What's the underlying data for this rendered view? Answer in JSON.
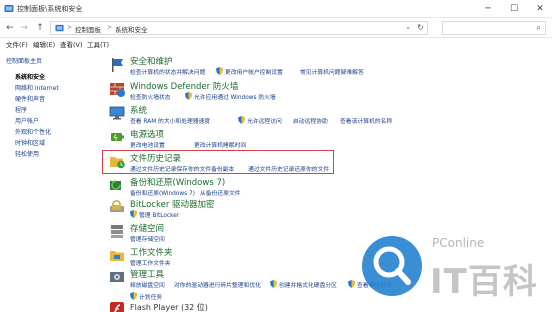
{
  "window": {
    "title": "控制面板\\系统和安全",
    "min_label": "─",
    "max_label": "☐",
    "close_label": "✕"
  },
  "nav": {
    "back": "←",
    "forward": "→",
    "up": "↑",
    "breadcrumb": [
      "控制面板",
      "系统和安全"
    ],
    "separator": ">",
    "dropdown": "⌄",
    "refresh": "↻",
    "search_icon": "⌕"
  },
  "menu": [
    "文件(F)",
    "编辑(E)",
    "查看(V)",
    "工具(T)"
  ],
  "sidebar": {
    "items": [
      {
        "label": "控制面板主页"
      },
      {
        "label": "系统和安全"
      },
      {
        "label": "网络和 Internet"
      },
      {
        "label": "硬件和声音"
      },
      {
        "label": "程序"
      },
      {
        "label": "用户帐户"
      },
      {
        "label": "外观和个性化"
      },
      {
        "label": "时钟和区域"
      },
      {
        "label": "轻松使用"
      }
    ],
    "current_index": 1
  },
  "categories": [
    {
      "title": "安全和维护",
      "links": [
        "检查计算机的状态并解决问题",
        "更改用户帐户控制设置",
        "常见计算机问题疑难解答"
      ]
    },
    {
      "title": "Windows Defender 防火墙",
      "links": [
        "检查防火墙状态",
        "允许应用通过 Windows 防火墙"
      ]
    },
    {
      "title": "系统",
      "links": [
        "查看 RAM 的大小和处理器速度",
        "允许远程访问",
        "启动远程协助",
        "查看该计算机的名称"
      ]
    },
    {
      "title": "电源选项",
      "links": [
        "更改电池设置",
        "更改计算机睡眠时间"
      ]
    },
    {
      "title": "文件历史记录",
      "links": [
        "通过文件历史记录保存你的文件备份副本",
        "通过文件历史记录还原你的文件"
      ]
    },
    {
      "title": "备份和还原(Windows 7)",
      "links": [
        "备份和还原(Windows 7)",
        "从备份还原文件"
      ]
    },
    {
      "title": "BitLocker 驱动器加密",
      "links": [
        "管理 BitLocker"
      ]
    },
    {
      "title": "存储空间",
      "links": [
        "管理存储空间"
      ]
    },
    {
      "title": "工作文件夹",
      "links": [
        "管理工作文件夹"
      ]
    },
    {
      "title": "管理工具",
      "links": [
        "释放磁盘空间",
        "对你的驱动器进行碎片整理和优化",
        "创建并格式化硬盘分区",
        "查看事件日志",
        "计划任务"
      ]
    },
    {
      "title": "Flash Player (32 位)",
      "links": []
    }
  ],
  "watermark": {
    "pconline": "PConline",
    "brand": "IT百科"
  },
  "colors": {
    "category_title": "#1e6b2e",
    "link": "#1a3f8a",
    "highlight_border": "#d6424a",
    "watermark_blue": "#1f7fcf"
  }
}
